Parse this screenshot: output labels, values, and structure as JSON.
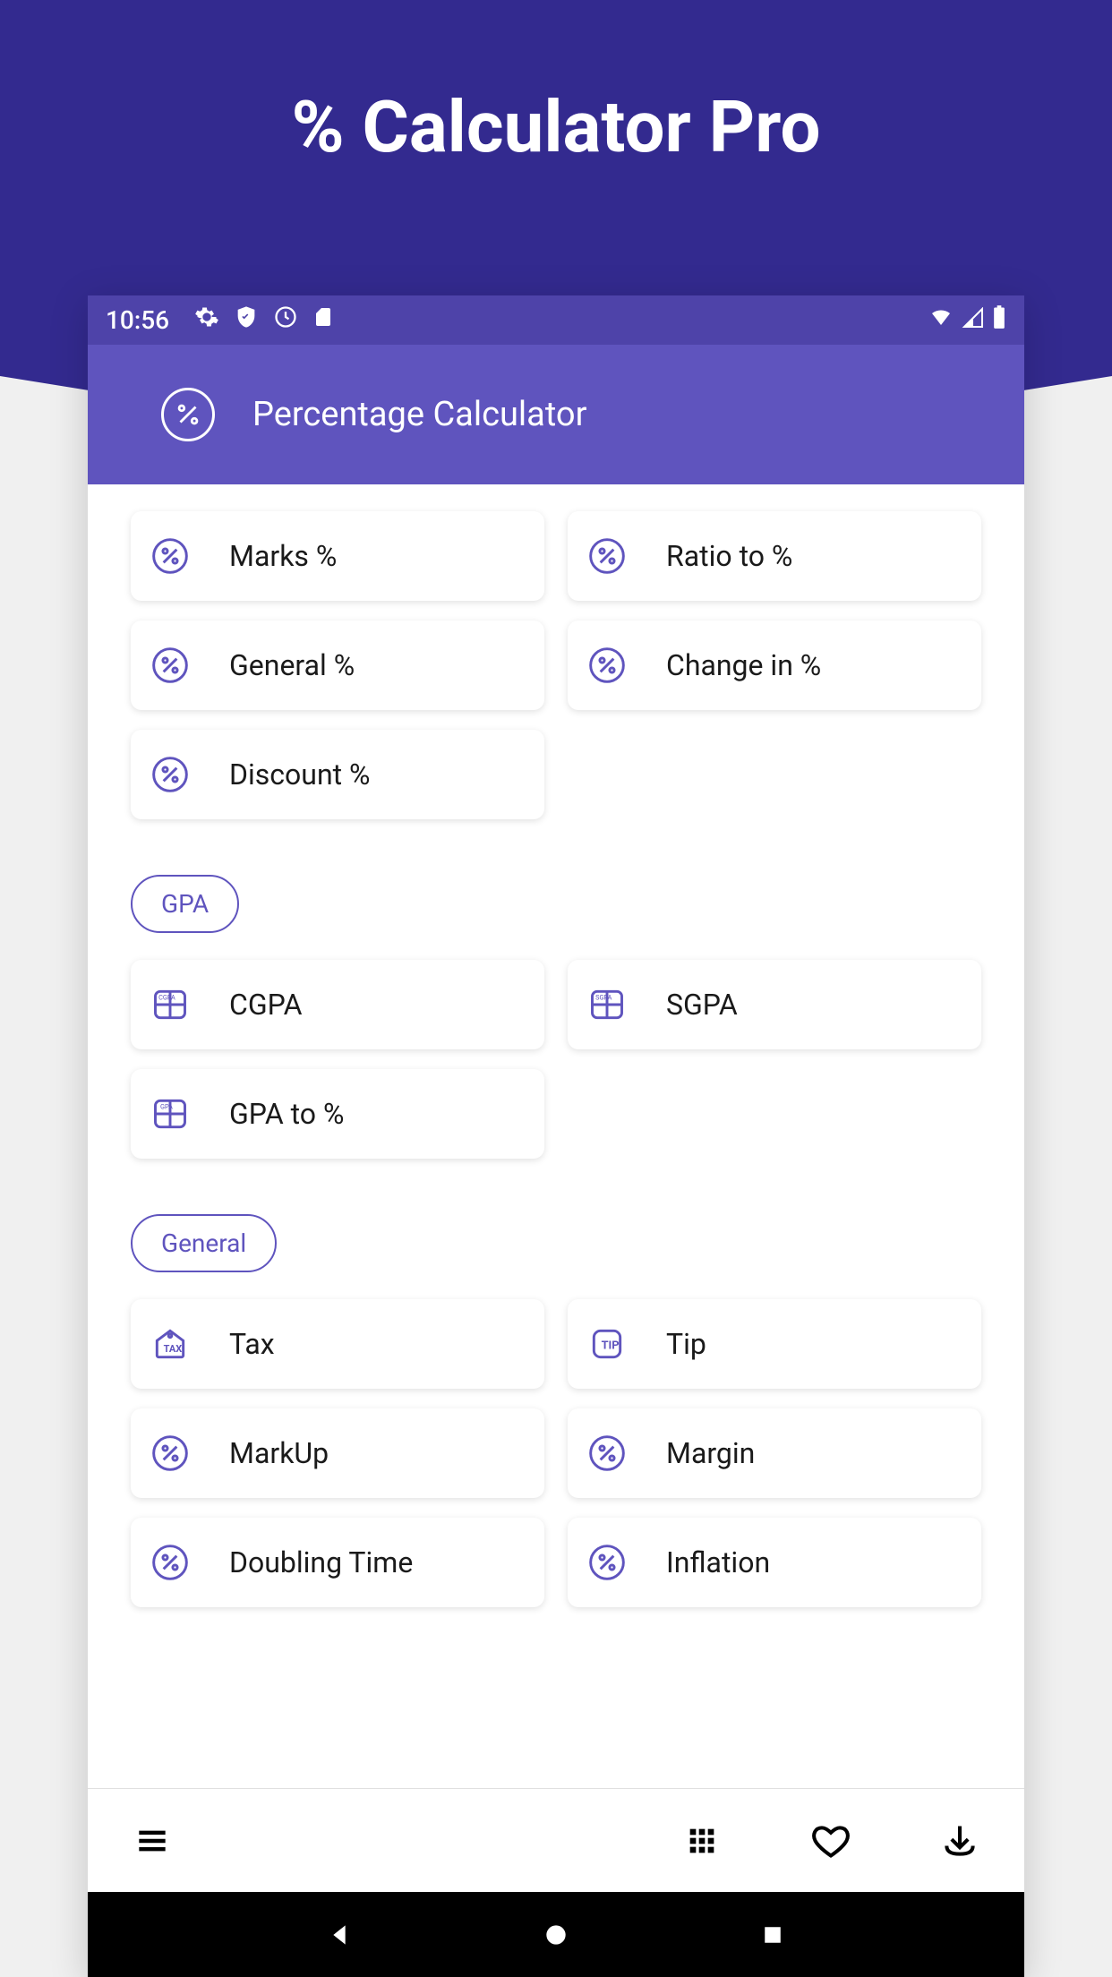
{
  "hero": {
    "title": "% Calculator Pro"
  },
  "status": {
    "time": "10:56"
  },
  "appbar": {
    "title": "Percentage Calculator"
  },
  "sections": {
    "top": {
      "items": [
        {
          "label": "Marks %",
          "icon": "percent"
        },
        {
          "label": "Ratio to %",
          "icon": "percent"
        },
        {
          "label": "General %",
          "icon": "percent"
        },
        {
          "label": "Change in %",
          "icon": "percent"
        },
        {
          "label": "Discount %",
          "icon": "percent"
        }
      ]
    },
    "gpa": {
      "title": "GPA",
      "items": [
        {
          "label": "CGPA",
          "icon": "gpa"
        },
        {
          "label": "SGPA",
          "icon": "gpa"
        },
        {
          "label": "GPA to %",
          "icon": "gpa"
        }
      ]
    },
    "general": {
      "title": "General",
      "items": [
        {
          "label": "Tax",
          "icon": "tax"
        },
        {
          "label": "Tip",
          "icon": "tip"
        },
        {
          "label": "MarkUp",
          "icon": "percent"
        },
        {
          "label": "Margin",
          "icon": "percent"
        },
        {
          "label": "Doubling Time",
          "icon": "percent"
        },
        {
          "label": "Inflation",
          "icon": "percent"
        }
      ]
    }
  },
  "colors": {
    "primary": "#5F54BE",
    "darkPrimary": "#332A8F",
    "statusBar": "#4E43A9"
  }
}
